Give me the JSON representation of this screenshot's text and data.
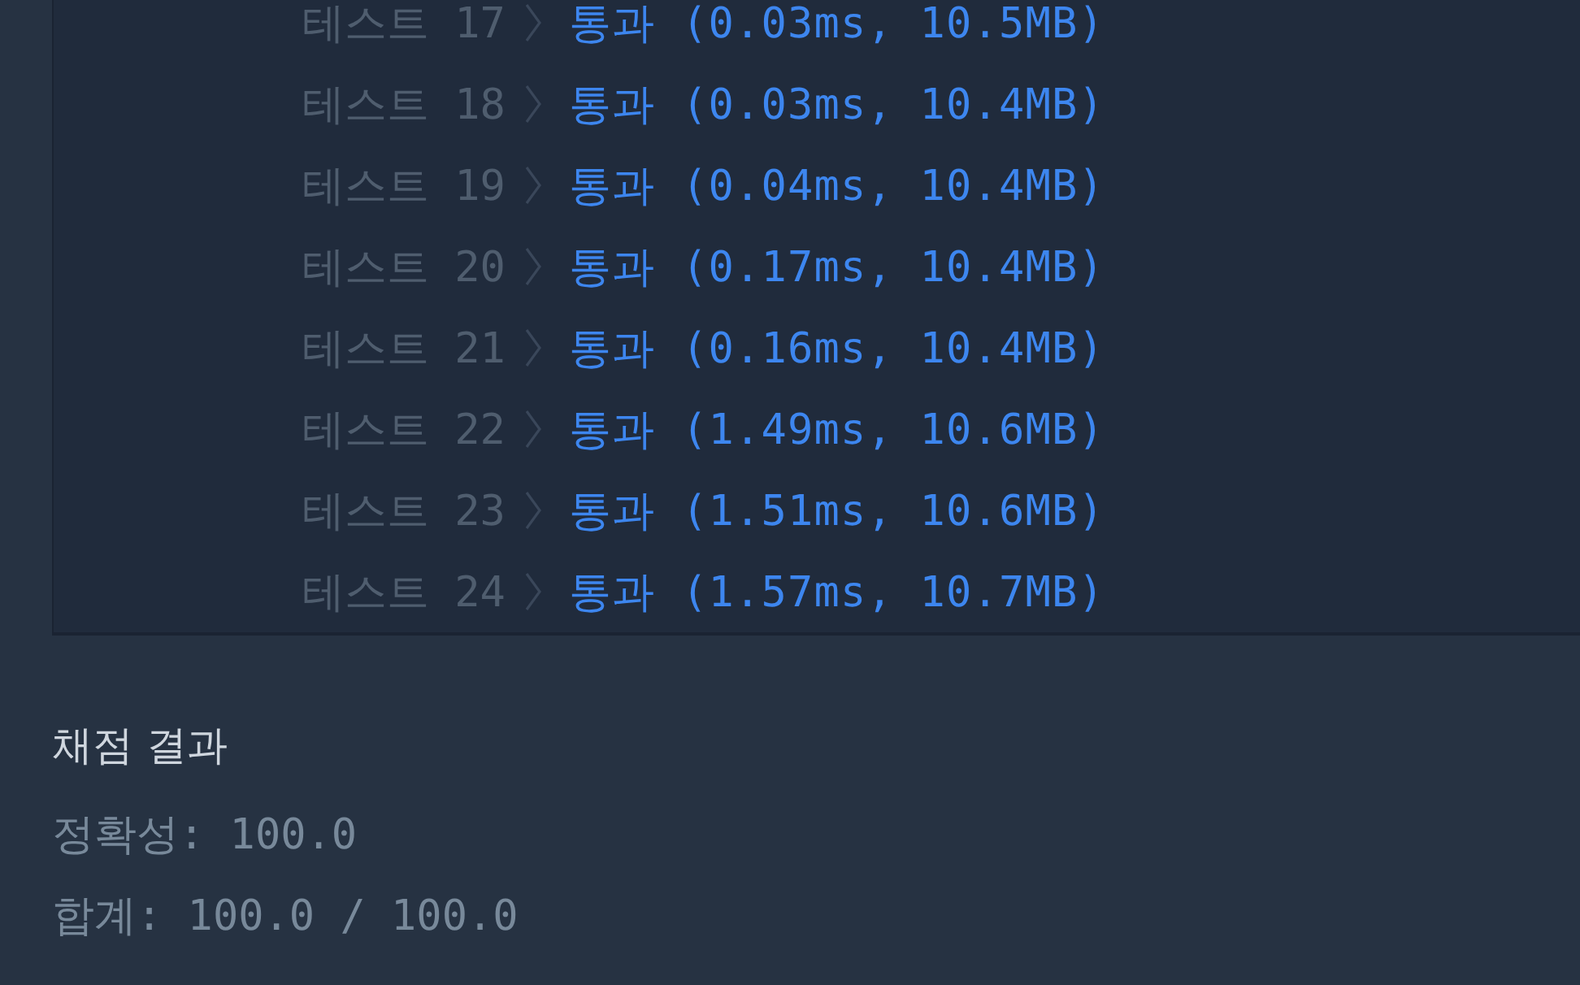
{
  "tests": [
    {
      "label": "테스트 17",
      "result": "통과 (0.03ms, 10.5MB)"
    },
    {
      "label": "테스트 18",
      "result": "통과 (0.03ms, 10.4MB)"
    },
    {
      "label": "테스트 19",
      "result": "통과 (0.04ms, 10.4MB)"
    },
    {
      "label": "테스트 20",
      "result": "통과 (0.17ms, 10.4MB)"
    },
    {
      "label": "테스트 21",
      "result": "통과 (0.16ms, 10.4MB)"
    },
    {
      "label": "테스트 22",
      "result": "통과 (1.49ms, 10.6MB)"
    },
    {
      "label": "테스트 23",
      "result": "통과 (1.51ms, 10.6MB)"
    },
    {
      "label": "테스트 24",
      "result": "통과 (1.57ms, 10.7MB)"
    }
  ],
  "grading": {
    "title": "채점 결과",
    "lines": [
      "정확성: 100.0",
      "합계: 100.0 / 100.0"
    ]
  }
}
